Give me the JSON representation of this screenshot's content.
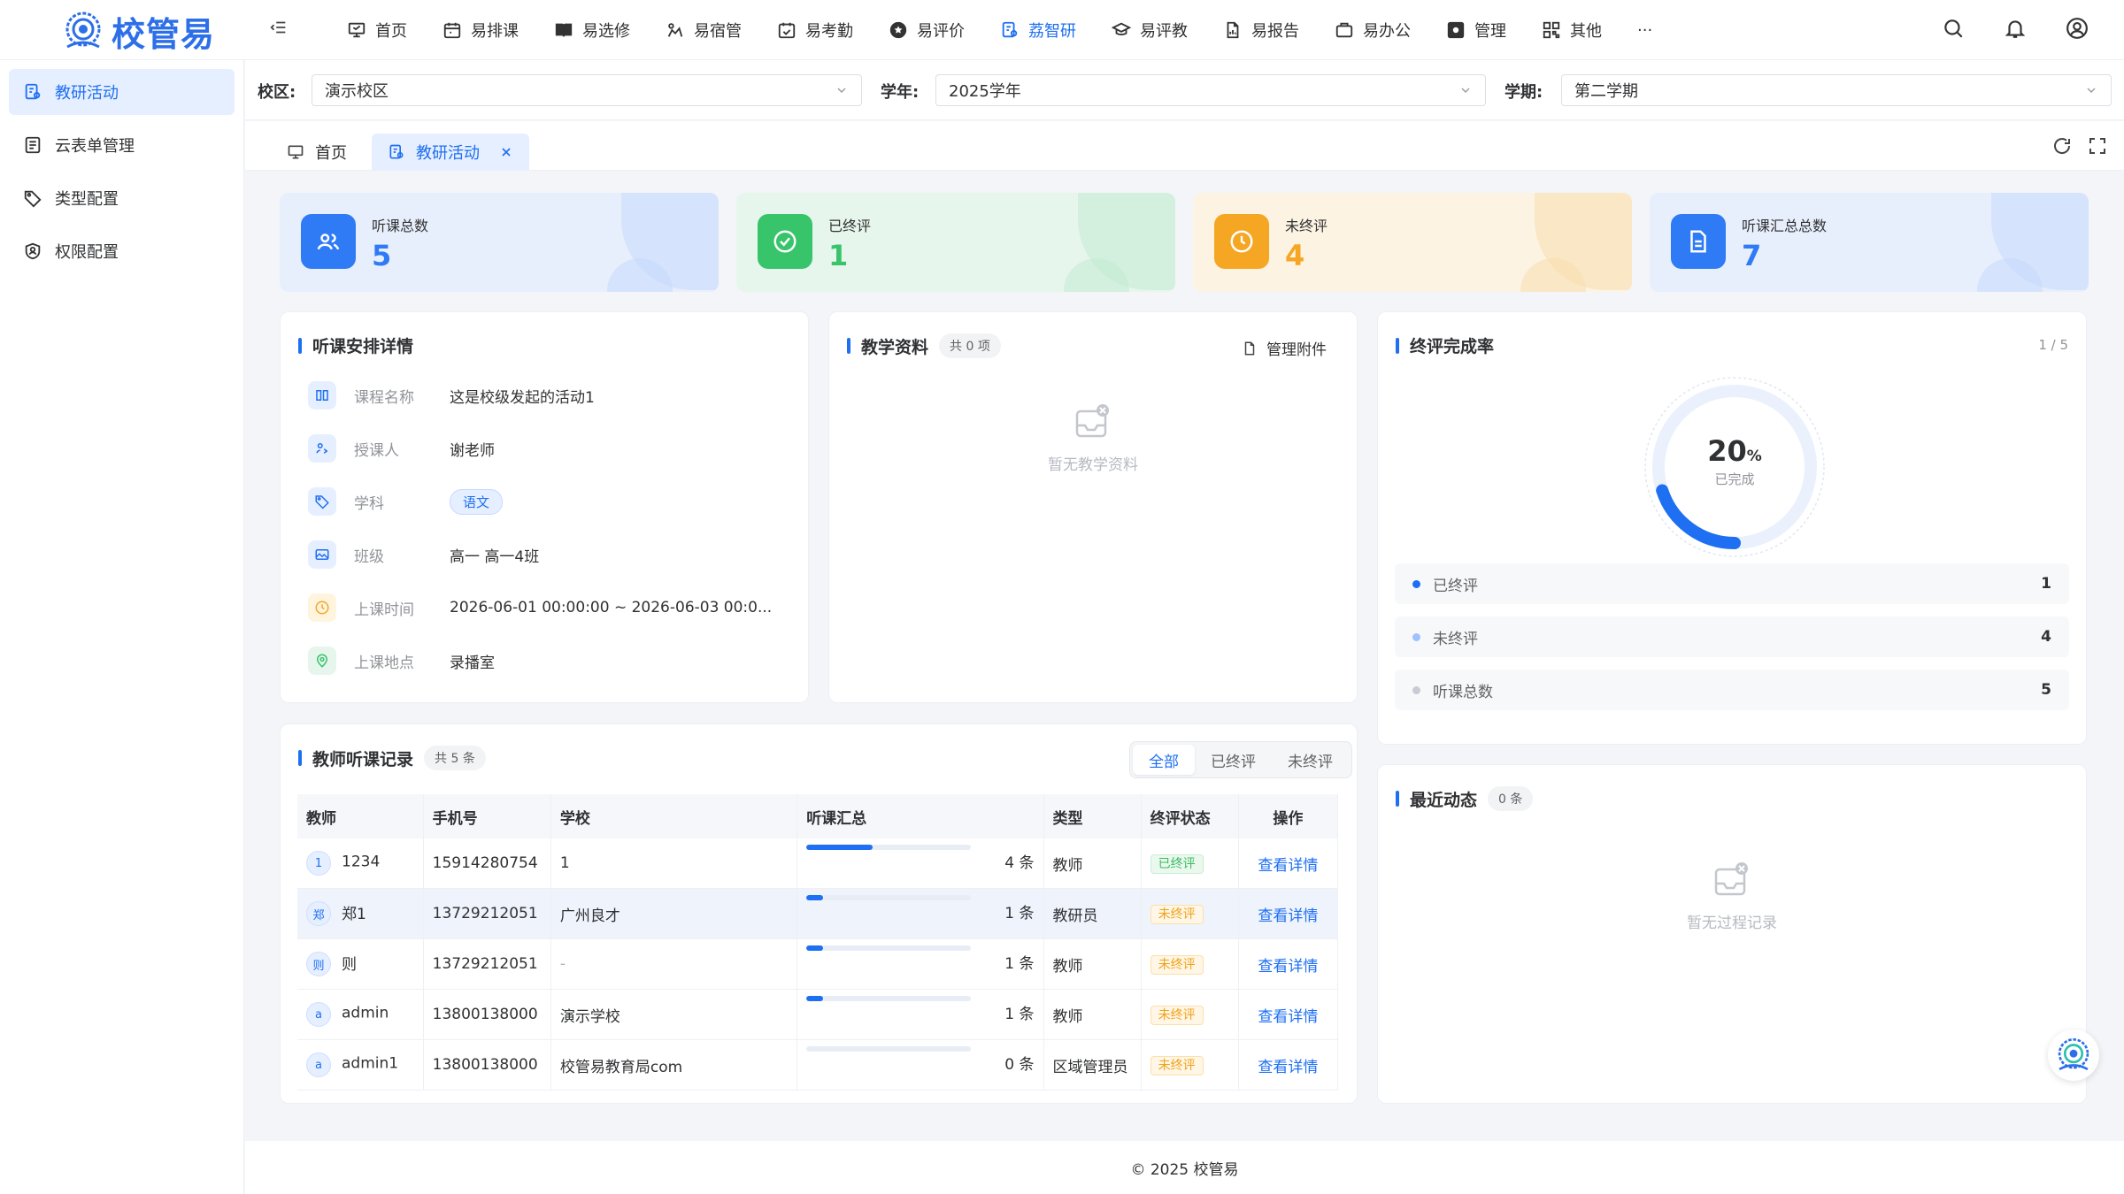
{
  "app": {
    "logo_text": "校管易",
    "brand_color": "#1e6ff2"
  },
  "nav": [
    {
      "label": "首页",
      "icon": "monitor-icon"
    },
    {
      "label": "易排课",
      "icon": "calendar-icon"
    },
    {
      "label": "易选修",
      "icon": "book-open-icon"
    },
    {
      "label": "易宿管",
      "icon": "bed-icon"
    },
    {
      "label": "易考勤",
      "icon": "calendar-check-icon"
    },
    {
      "label": "易评价",
      "icon": "star-badge-icon"
    },
    {
      "label": "荔智研",
      "icon": "research-icon",
      "active": true
    },
    {
      "label": "易评教",
      "icon": "graduation-cap-icon"
    },
    {
      "label": "易报告",
      "icon": "report-icon"
    },
    {
      "label": "易办公",
      "icon": "briefcase-icon"
    },
    {
      "label": "管理",
      "icon": "settings-box-icon"
    },
    {
      "label": "其他",
      "icon": "grid-icon"
    }
  ],
  "nav_more": "···",
  "sidebar": [
    {
      "label": "教研活动",
      "icon": "research-icon",
      "active": true
    },
    {
      "label": "云表单管理",
      "icon": "form-icon"
    },
    {
      "label": "类型配置",
      "icon": "tags-icon"
    },
    {
      "label": "权限配置",
      "icon": "shield-user-icon"
    }
  ],
  "filters": {
    "campus_label": "校区:",
    "campus_value": "演示校区",
    "year_label": "学年:",
    "year_value": "2025学年",
    "term_label": "学期:",
    "term_value": "第二学期"
  },
  "tabs": [
    {
      "label": "首页"
    },
    {
      "label": "教研活动",
      "active": true
    }
  ],
  "stats": [
    {
      "label": "听课总数",
      "value": "5",
      "color": "#2f7bf5"
    },
    {
      "label": "已终评",
      "value": "1",
      "color": "#37c46a"
    },
    {
      "label": "未终评",
      "value": "4",
      "color": "#f5a623"
    },
    {
      "label": "听课汇总总数",
      "value": "7",
      "color": "#2f7bf5"
    }
  ],
  "detail": {
    "title": "听课安排详情",
    "rows": [
      {
        "label": "课程名称",
        "value": "这是校级发起的活动1"
      },
      {
        "label": "授课人",
        "value": "谢老师"
      },
      {
        "label": "学科",
        "value": "语文"
      },
      {
        "label": "班级",
        "value": "高一 高一4班"
      },
      {
        "label": "上课时间",
        "value": "2026-06-01 00:00:00 ~ 2026-06-03 00:0..."
      },
      {
        "label": "上课地点",
        "value": "录播室"
      }
    ]
  },
  "materials": {
    "title": "教学资料",
    "count": "共 0 项",
    "manage": "管理附件",
    "empty": "暂无教学资料"
  },
  "completion": {
    "title": "终评完成率",
    "page": "1 / 5",
    "percent": "20",
    "percent_unit": "%",
    "fraction": 0.2,
    "sub": "已完成",
    "legend": [
      {
        "label": "已终评",
        "count": "1",
        "color": "#1e6ff2"
      },
      {
        "label": "未终评",
        "count": "4",
        "color": "#9fc2ff"
      },
      {
        "label": "听课总数",
        "count": "5",
        "color": "#c8cbd1"
      }
    ]
  },
  "records": {
    "title": "教师听课记录",
    "count": "共 5 条",
    "filters": [
      "全部",
      "已终评",
      "未终评"
    ],
    "columns": [
      "教师",
      "手机号",
      "学校",
      "听课汇总",
      "类型",
      "终评状态",
      "操作"
    ],
    "rows": [
      {
        "avatar": "1",
        "name": "1234",
        "phone": "15914280754",
        "school": "1",
        "progress": 0.4,
        "summary": "4 条",
        "type": "教师",
        "status": "已终评",
        "done": true,
        "action": "查看详情"
      },
      {
        "avatar": "郑",
        "name": "郑1",
        "phone": "13729212051",
        "school": "广州良才",
        "progress": 0.1,
        "summary": "1 条",
        "type": "教研员",
        "status": "未终评",
        "done": false,
        "action": "查看详情"
      },
      {
        "avatar": "则",
        "name": "则",
        "phone": "13729212051",
        "school": "-",
        "progress": 0.1,
        "summary": "1 条",
        "type": "教师",
        "status": "未终评",
        "done": false,
        "action": "查看详情"
      },
      {
        "avatar": "a",
        "name": "admin",
        "phone": "13800138000",
        "school": "演示学校",
        "progress": 0.1,
        "summary": "1 条",
        "type": "教师",
        "status": "未终评",
        "done": false,
        "action": "查看详情"
      },
      {
        "avatar": "a",
        "name": "admin1",
        "phone": "13800138000",
        "school": "校管易教育局com",
        "progress": 0,
        "summary": "0 条",
        "type": "区域管理员",
        "status": "未终评",
        "done": false,
        "action": "查看详情"
      }
    ]
  },
  "recent": {
    "title": "最近动态",
    "count": "0 条",
    "empty": "暂无过程记录"
  },
  "footer": "© 2025 校管易"
}
